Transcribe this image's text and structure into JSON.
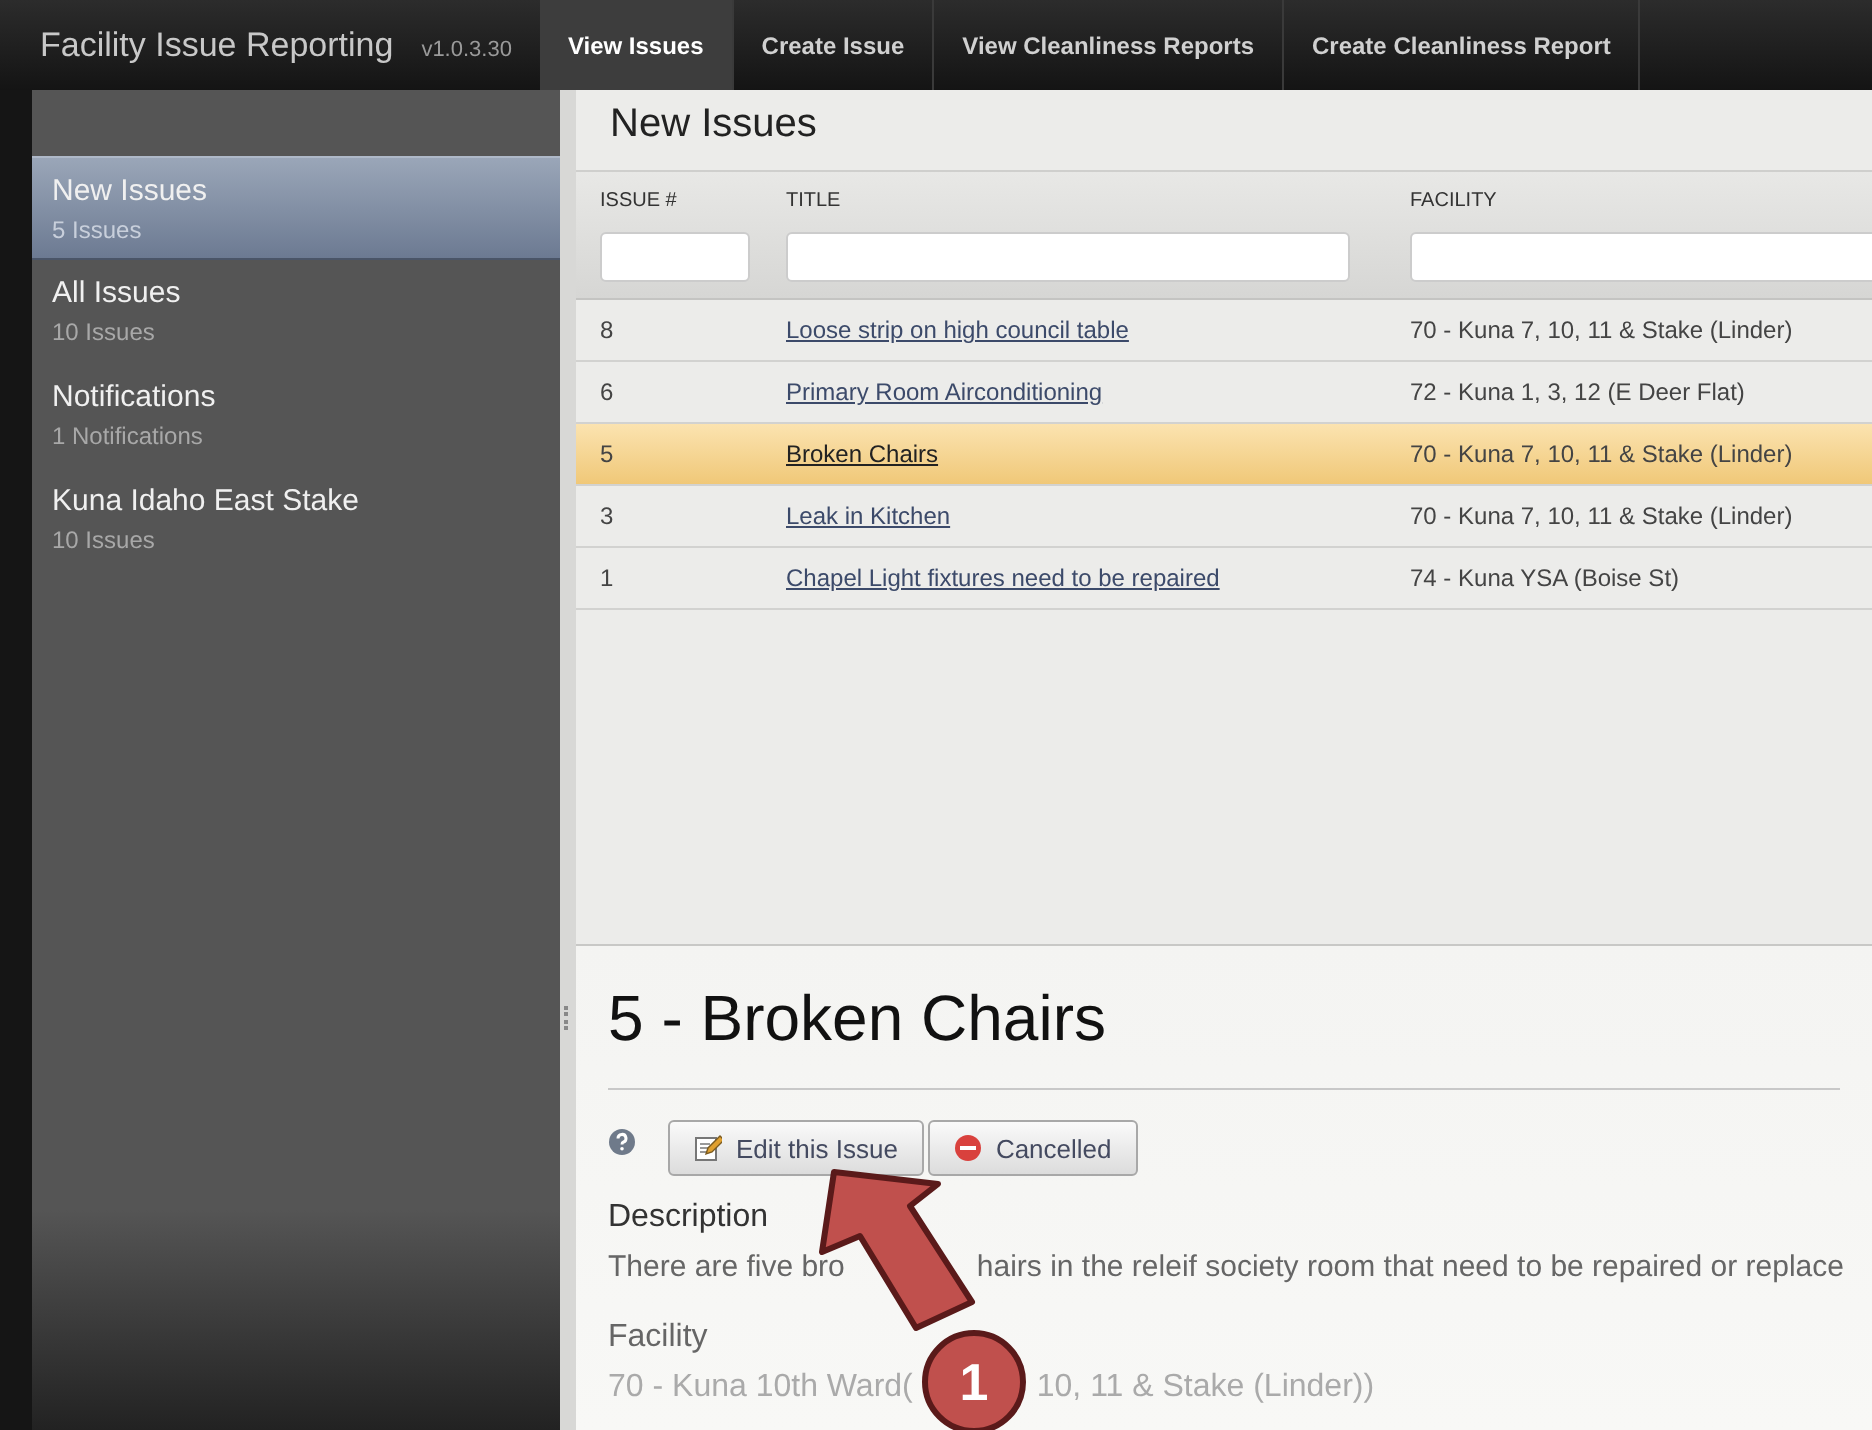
{
  "app": {
    "title": "Facility Issue Reporting",
    "version": "v1.0.3.30"
  },
  "nav_tabs": [
    {
      "label": "View Issues",
      "selected": true
    },
    {
      "label": "Create Issue",
      "selected": false
    },
    {
      "label": "View Cleanliness Reports",
      "selected": false
    },
    {
      "label": "Create Cleanliness Report",
      "selected": false
    }
  ],
  "sidebar": {
    "items": [
      {
        "label": "New Issues",
        "count": "5 Issues",
        "selected": true
      },
      {
        "label": "All Issues",
        "count": "10 Issues",
        "selected": false
      },
      {
        "label": "Notifications",
        "count": "1 Notifications",
        "selected": false
      },
      {
        "label": "Kuna Idaho East Stake",
        "count": "10 Issues",
        "selected": false
      }
    ]
  },
  "issue_list": {
    "title": "New Issues",
    "columns": [
      "ISSUE #",
      "TITLE",
      "FACILITY"
    ],
    "rows": [
      {
        "number": "8",
        "title": "Loose strip on high council table",
        "facility": "70 - Kuna 7, 10, 11 & Stake (Linder)",
        "selected": false
      },
      {
        "number": "6",
        "title": "Primary Room Airconditioning",
        "facility": "72 - Kuna 1, 3, 12 (E Deer Flat)",
        "selected": false
      },
      {
        "number": "5",
        "title": "Broken Chairs",
        "facility": "70 - Kuna 7, 10, 11 & Stake (Linder)",
        "selected": true
      },
      {
        "number": "3",
        "title": "Leak in Kitchen",
        "facility": "70 - Kuna 7, 10, 11 & Stake (Linder)",
        "selected": false
      },
      {
        "number": "1",
        "title": "Chapel Light fixtures need to be repaired",
        "facility": "74 - Kuna YSA (Boise St)",
        "selected": false
      }
    ]
  },
  "detail": {
    "title": "5 - Broken Chairs",
    "buttons": [
      {
        "label": "Edit this Issue",
        "kind": "edit"
      },
      {
        "label": "Cancelled",
        "kind": "cancel"
      }
    ],
    "fields": [
      {
        "label": "Description",
        "value_parts": [
          "There are five bro",
          "hairs in the releif society room that need to be repaired or replace"
        ]
      },
      {
        "label": "Facility",
        "value_parts": [
          "70 - Kuna 10th Ward(",
          "10, 11 & Stake (Linder))"
        ]
      }
    ]
  },
  "annotation": {
    "number": "1"
  }
}
